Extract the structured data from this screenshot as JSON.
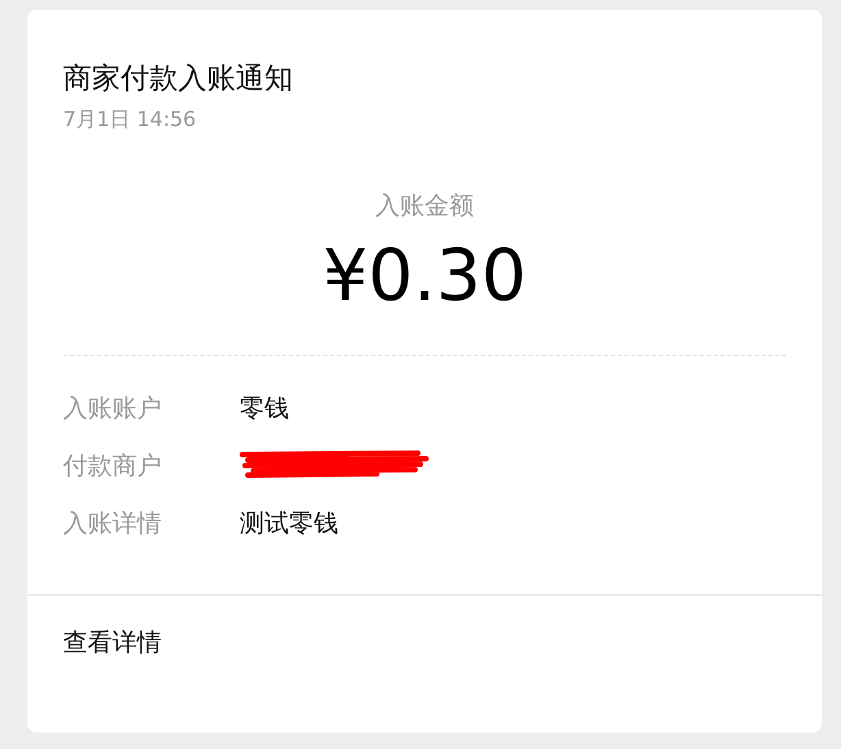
{
  "notification": {
    "title": "商家付款入账通知",
    "date": "7月1日  14:56"
  },
  "amount": {
    "label": "入账金额",
    "value": "¥0.30"
  },
  "rows": [
    {
      "kind": "text",
      "label": "入账账户",
      "value": "零钱"
    },
    {
      "kind": "redacted",
      "label": "付款商户"
    },
    {
      "kind": "text",
      "label": "入账详情",
      "value": "测试零钱"
    }
  ],
  "footer_link": "查看详情"
}
